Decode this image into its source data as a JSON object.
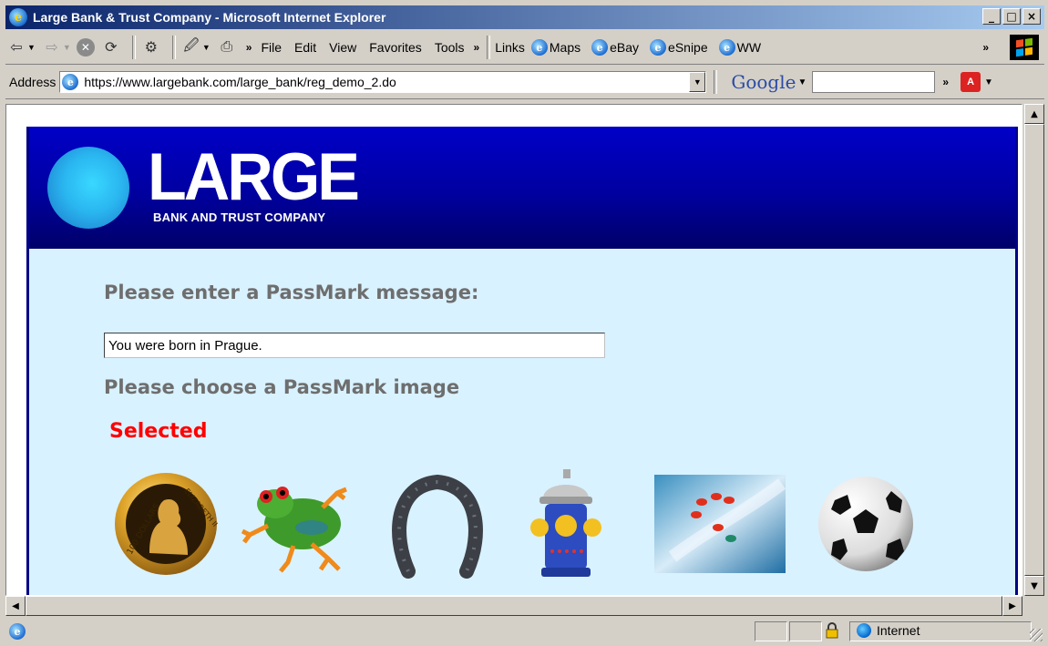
{
  "window": {
    "title": "Large Bank & Trust Company - Microsoft Internet Explorer",
    "controls": [
      "_",
      "□",
      "×"
    ]
  },
  "toolbar": {
    "menus": [
      "File",
      "Edit",
      "View",
      "Favorites",
      "Tools"
    ],
    "links_label": "Links",
    "links": [
      "Maps",
      "eBay",
      "eSnipe",
      "WW"
    ]
  },
  "addressbar": {
    "label": "Address",
    "url": "https://www.largebank.com/large_bank/reg_demo_2.do",
    "google_label": "Google"
  },
  "page": {
    "logo_title": "LARGE",
    "logo_subtitle": "BANK AND TRUST COMPANY",
    "message_prompt": "Please enter a PassMark message:",
    "message_value": "You were born in Prague.",
    "image_prompt": "Please choose a PassMark image",
    "selected_label": "Selected",
    "images": [
      "gold-coin",
      "tree-frog",
      "horseshoe",
      "fire-hydrant",
      "flower-closeup",
      "soccer-ball"
    ],
    "coin_text": [
      "100 DOLLARS",
      "ELIZABETH II"
    ]
  },
  "statusbar": {
    "zone": "Internet"
  },
  "colors": {
    "header_blue": "#0000a0",
    "page_bg": "#d9f2ff",
    "selected_red": "#ff0000",
    "prompt_gray": "#6e6e6e"
  }
}
